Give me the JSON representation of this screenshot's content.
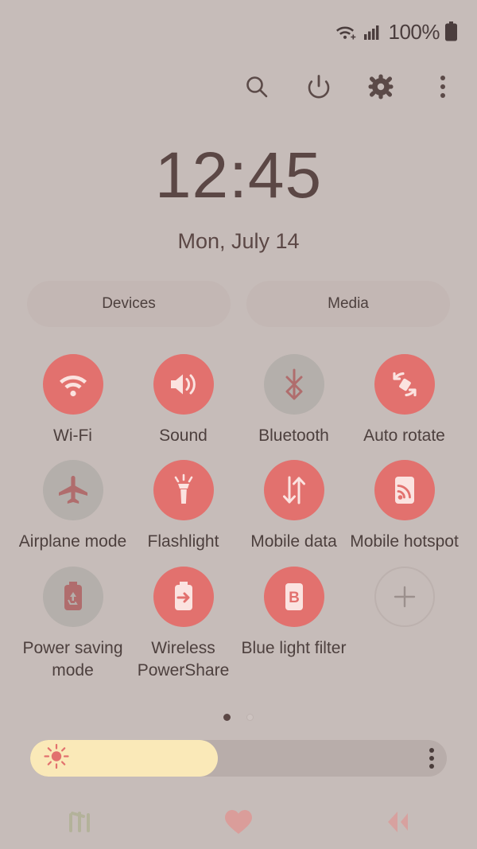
{
  "status_bar": {
    "wifi_icon": "wifi-calling-icon",
    "signal_icon": "cellular-signal-icon",
    "battery_percent": "100%",
    "battery_icon": "battery-full-icon"
  },
  "header": {
    "search_icon": "search-icon",
    "power_icon": "power-icon",
    "settings_icon": "gear-icon",
    "more_icon": "more-vertical-icon"
  },
  "clock": {
    "time": "12:45",
    "date": "Mon, July 14"
  },
  "pills": [
    {
      "label": "Devices",
      "name": "devices-button"
    },
    {
      "label": "Media",
      "name": "media-button"
    }
  ],
  "toggles": [
    {
      "label": "Wi-Fi",
      "icon": "wifi-icon",
      "state": "on"
    },
    {
      "label": "Sound",
      "icon": "sound-icon",
      "state": "on"
    },
    {
      "label": "Bluetooth",
      "icon": "bluetooth-icon",
      "state": "off"
    },
    {
      "label": "Auto rotate",
      "icon": "auto-rotate-icon",
      "state": "on"
    },
    {
      "label": "Airplane mode",
      "icon": "airplane-icon",
      "state": "off"
    },
    {
      "label": "Flashlight",
      "icon": "flashlight-icon",
      "state": "on"
    },
    {
      "label": "Mobile data",
      "icon": "mobile-data-icon",
      "state": "on"
    },
    {
      "label": "Mobile hotspot",
      "icon": "hotspot-icon",
      "state": "on"
    },
    {
      "label": "Power saving mode",
      "icon": "power-saving-icon",
      "state": "off"
    },
    {
      "label": "Wireless PowerShare",
      "icon": "powershare-icon",
      "state": "on"
    },
    {
      "label": "Blue light filter",
      "icon": "blue-light-icon",
      "state": "on"
    },
    {
      "label": "",
      "icon": "add-icon",
      "state": "add"
    }
  ],
  "pagination": {
    "total": 2,
    "current": 1
  },
  "brightness": {
    "value_percent": 45,
    "sun_icon": "brightness-sun-icon",
    "menu_icon": "more-vertical-icon"
  },
  "navbar": [
    {
      "name": "nav-recents-button",
      "icon": "recents-icon"
    },
    {
      "name": "nav-home-button",
      "icon": "home-icon"
    },
    {
      "name": "nav-back-button",
      "icon": "back-icon"
    }
  ],
  "colors": {
    "background": "#c6bcb9",
    "accent_active": "#e2716e",
    "toggle_inactive": "#b4afab",
    "text": "#4d403e",
    "slider_fill": "#fae9b8"
  }
}
